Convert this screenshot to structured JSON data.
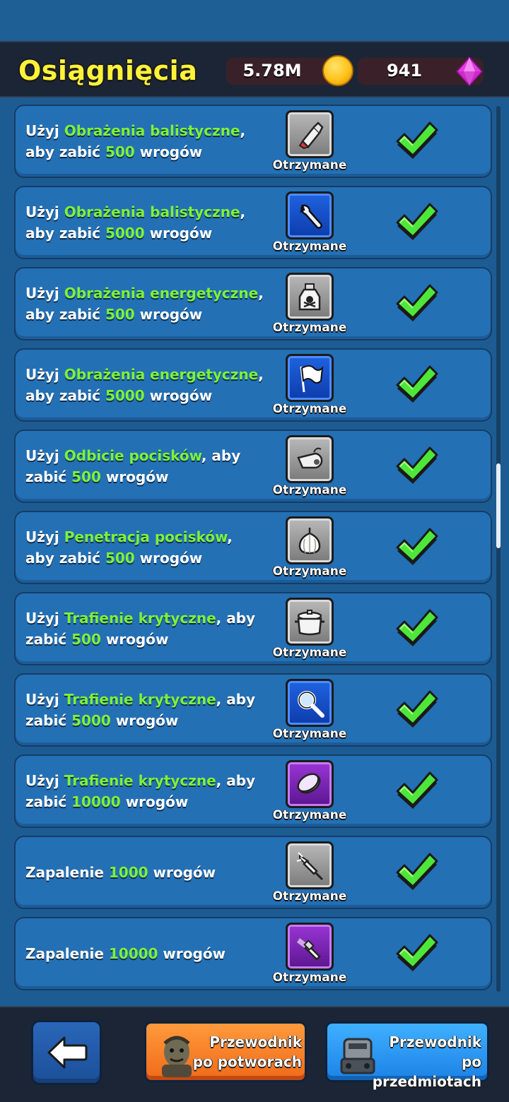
{
  "header": {
    "title": "Osiągnięcia",
    "coins": "5.78M",
    "gems": "941"
  },
  "achievements": [
    {
      "prefix": "Użyj ",
      "highlight": "Obrażenia balistyczne",
      "middle": ", aby zabić ",
      "number": "500",
      "suffix": " wrogów",
      "status": "Otrzymane",
      "icon": "glue-tube-icon",
      "badge": "gray"
    },
    {
      "prefix": "Użyj ",
      "highlight": "Obrażenia balistyczne",
      "middle": ", aby zabić ",
      "number": "5000",
      "suffix": " wrogów",
      "status": "Otrzymane",
      "icon": "wrench-icon",
      "badge": "blue"
    },
    {
      "prefix": "Użyj ",
      "highlight": "Obrażenia energetyczne",
      "middle": ", aby zabić ",
      "number": "500",
      "suffix": " wrogów",
      "status": "Otrzymane",
      "icon": "poison-bottle-icon",
      "badge": "gray"
    },
    {
      "prefix": "Użyj ",
      "highlight": "Obrażenia energetyczne",
      "middle": ", aby zabić ",
      "number": "5000",
      "suffix": " wrogów",
      "status": "Otrzymane",
      "icon": "flag-icon",
      "badge": "blue"
    },
    {
      "prefix": "Użyj ",
      "highlight": "Odbicie pocisków",
      "middle": ", aby zabić ",
      "number": "500",
      "suffix": " wrogów",
      "status": "Otrzymane",
      "icon": "whistle-icon",
      "badge": "gray"
    },
    {
      "prefix": "Użyj ",
      "highlight": "Penetracja pocisków",
      "middle": ", aby zabić ",
      "number": "500",
      "suffix": " wrogów",
      "status": "Otrzymane",
      "icon": "garlic-icon",
      "badge": "gray"
    },
    {
      "prefix": "Użyj ",
      "highlight": "Trafienie krytyczne",
      "middle": ", aby zabić ",
      "number": "500",
      "suffix": " wrogów",
      "status": "Otrzymane",
      "icon": "pot-icon",
      "badge": "gray"
    },
    {
      "prefix": "Użyj ",
      "highlight": "Trafienie krytyczne",
      "middle": ", aby zabić ",
      "number": "5000",
      "suffix": " wrogów",
      "status": "Otrzymane",
      "icon": "magnifier-icon",
      "badge": "blue"
    },
    {
      "prefix": "Użyj ",
      "highlight": "Trafienie krytyczne",
      "middle": ", aby zabić ",
      "number": "10000",
      "suffix": " wrogów",
      "status": "Otrzymane",
      "icon": "coin-stack-icon",
      "badge": "purple"
    },
    {
      "prefix": "Zapalenie ",
      "highlight": "",
      "middle": "",
      "number": "1000",
      "suffix": " wrogów",
      "status": "Otrzymane",
      "icon": "drill-icon",
      "badge": "gray"
    },
    {
      "prefix": "Zapalenie ",
      "highlight": "",
      "middle": "",
      "number": "10000",
      "suffix": " wrogów",
      "status": "Otrzymane",
      "icon": "flashlight-icon",
      "badge": "purple"
    }
  ],
  "footer": {
    "monster_guide": "Przewodnik po potworach",
    "item_guide": "Przewodnik po przedmiotach"
  },
  "colors": {
    "highlight": "#7cf23a",
    "title": "#fff23a",
    "check": "#4ee63a"
  }
}
